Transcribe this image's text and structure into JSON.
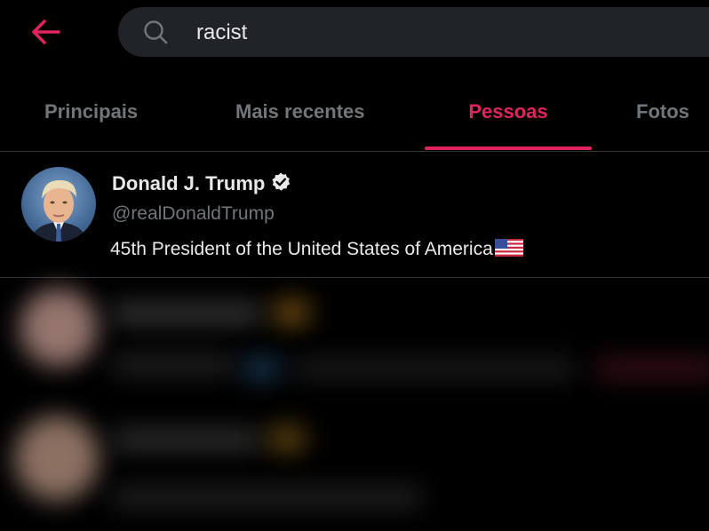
{
  "search": {
    "query": "racist"
  },
  "tabs": [
    {
      "label": "Principais"
    },
    {
      "label": "Mais recentes"
    },
    {
      "label": "Pessoas"
    },
    {
      "label": "Fotos"
    }
  ],
  "results": [
    {
      "name": "Donald J. Trump",
      "handle": "@realDonaldTrump",
      "bio": "45th President of the United States of America",
      "verified": true,
      "bio_emoji": "us-flag-icon"
    }
  ],
  "colors": {
    "accent": "#e0245e",
    "background": "#000000",
    "muted": "#71767b",
    "search_bg": "#202327"
  }
}
